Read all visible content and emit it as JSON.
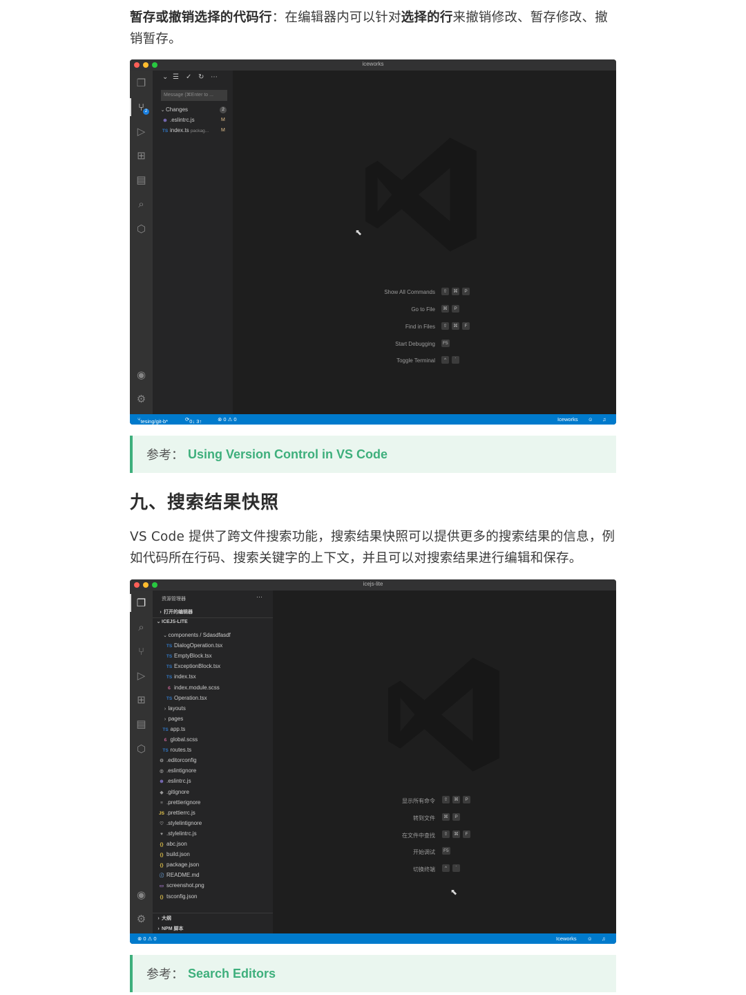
{
  "intro": {
    "bold1": "暂存或撤销选择的代码行",
    "text1": "：在编辑器内可以针对",
    "bold2": "选择的行",
    "text2": "来撤销修改、暂存修改、撤销暂存。"
  },
  "window1": {
    "title": "iceworks",
    "scm_badge": "2",
    "message_placeholder": "Message (⌘Enter to ...",
    "changes_label": "Changes",
    "changes_count": "2",
    "files": [
      {
        "icon": "⊛",
        "name": ".eslintrc.js",
        "path": "",
        "status": "M"
      },
      {
        "icon": "TS",
        "name": "index.ts",
        "path": "packag...",
        "status": "M"
      }
    ],
    "shortcuts": [
      {
        "label": "Show All Commands",
        "keys": [
          "⇧",
          "⌘",
          "P"
        ]
      },
      {
        "label": "Go to File",
        "keys": [
          "⌘",
          "P"
        ]
      },
      {
        "label": "Find in Files",
        "keys": [
          "⇧",
          "⌘",
          "F"
        ]
      },
      {
        "label": "Start Debugging",
        "keys": [
          "F5"
        ]
      },
      {
        "label": "Toggle Terminal",
        "keys": [
          "^",
          "`"
        ]
      }
    ],
    "status": {
      "branch": "tesing/git-b*",
      "sync": "0↓ 3↑",
      "problems": "⊗ 0 ⚠ 0",
      "right": "Iceworks"
    }
  },
  "ref1": {
    "label": "参考：",
    "link": "Using Version Control in VS Code"
  },
  "heading": "九、搜索结果快照",
  "para2": "VS Code 提供了跨文件搜索功能，搜索结果快照可以提供更多的搜索结果的信息，例如代码所在行码、搜索关键字的上下文，并且可以对搜索结果进行编辑和保存。",
  "window2": {
    "title": "icejs-lite",
    "explorer_title": "资源管理器",
    "open_editors": "打开的编辑器",
    "project": "ICEJS-LITE",
    "tree": [
      {
        "depth": 1,
        "type": "folder",
        "icon": "⌄",
        "name": "components / Sdasdfasdf"
      },
      {
        "depth": 2,
        "type": "ts",
        "icon": "TS",
        "name": "DialogOperation.tsx"
      },
      {
        "depth": 2,
        "type": "ts",
        "icon": "TS",
        "name": "EmptyBlock.tsx"
      },
      {
        "depth": 2,
        "type": "ts",
        "icon": "TS",
        "name": "ExceptionBlock.tsx"
      },
      {
        "depth": 2,
        "type": "ts",
        "icon": "TS",
        "name": "index.tsx"
      },
      {
        "depth": 2,
        "type": "scss",
        "icon": "ϐ",
        "name": "index.module.scss"
      },
      {
        "depth": 2,
        "type": "ts",
        "icon": "TS",
        "name": "Operation.tsx"
      },
      {
        "depth": 1,
        "type": "folder",
        "icon": "›",
        "name": "layouts"
      },
      {
        "depth": 1,
        "type": "folder",
        "icon": "›",
        "name": "pages"
      },
      {
        "depth": 1,
        "type": "ts",
        "icon": "TS",
        "name": "app.ts"
      },
      {
        "depth": 1,
        "type": "scss",
        "icon": "ϐ",
        "name": "global.scss"
      },
      {
        "depth": 1,
        "type": "ts",
        "icon": "TS",
        "name": "routes.ts"
      },
      {
        "depth": 0,
        "type": "gray",
        "icon": "⚙",
        "name": ".editorconfig"
      },
      {
        "depth": 0,
        "type": "gray",
        "icon": "◎",
        "name": ".eslintignore"
      },
      {
        "depth": 0,
        "type": "eslint",
        "icon": "⊛",
        "name": ".eslintrc.js"
      },
      {
        "depth": 0,
        "type": "gray",
        "icon": "◆",
        "name": ".gitignore"
      },
      {
        "depth": 0,
        "type": "gray",
        "icon": "≡",
        "name": ".prettierignore"
      },
      {
        "depth": 0,
        "type": "js",
        "icon": "JS",
        "name": ".prettierrc.js"
      },
      {
        "depth": 0,
        "type": "gray",
        "icon": "♡",
        "name": ".stylelintignore"
      },
      {
        "depth": 0,
        "type": "gray",
        "icon": "♥",
        "name": ".stylelintrc.js"
      },
      {
        "depth": 0,
        "type": "json",
        "icon": "{}",
        "name": "abc.json"
      },
      {
        "depth": 0,
        "type": "json",
        "icon": "{}",
        "name": "build.json"
      },
      {
        "depth": 0,
        "type": "json",
        "icon": "{}",
        "name": "package.json"
      },
      {
        "depth": 0,
        "type": "info",
        "icon": "ⓘ",
        "name": "README.md"
      },
      {
        "depth": 0,
        "type": "img",
        "icon": "▭",
        "name": "screenshot.png"
      },
      {
        "depth": 0,
        "type": "json",
        "icon": "{}",
        "name": "tsconfig.json"
      }
    ],
    "outline": "大纲",
    "npm": "NPM 脚本",
    "shortcuts": [
      {
        "label": "显示所有命令",
        "keys": [
          "⇧",
          "⌘",
          "P"
        ]
      },
      {
        "label": "转到文件",
        "keys": [
          "⌘",
          "P"
        ]
      },
      {
        "label": "在文件中查找",
        "keys": [
          "⇧",
          "⌘",
          "F"
        ]
      },
      {
        "label": "开始调试",
        "keys": [
          "F5"
        ]
      },
      {
        "label": "切换终端",
        "keys": [
          "^",
          "`"
        ]
      }
    ],
    "status": {
      "problems": "⊗ 0 ⚠ 0",
      "right": "Iceworks"
    }
  },
  "ref2": {
    "label": "参考：",
    "link": "Search Editors"
  }
}
